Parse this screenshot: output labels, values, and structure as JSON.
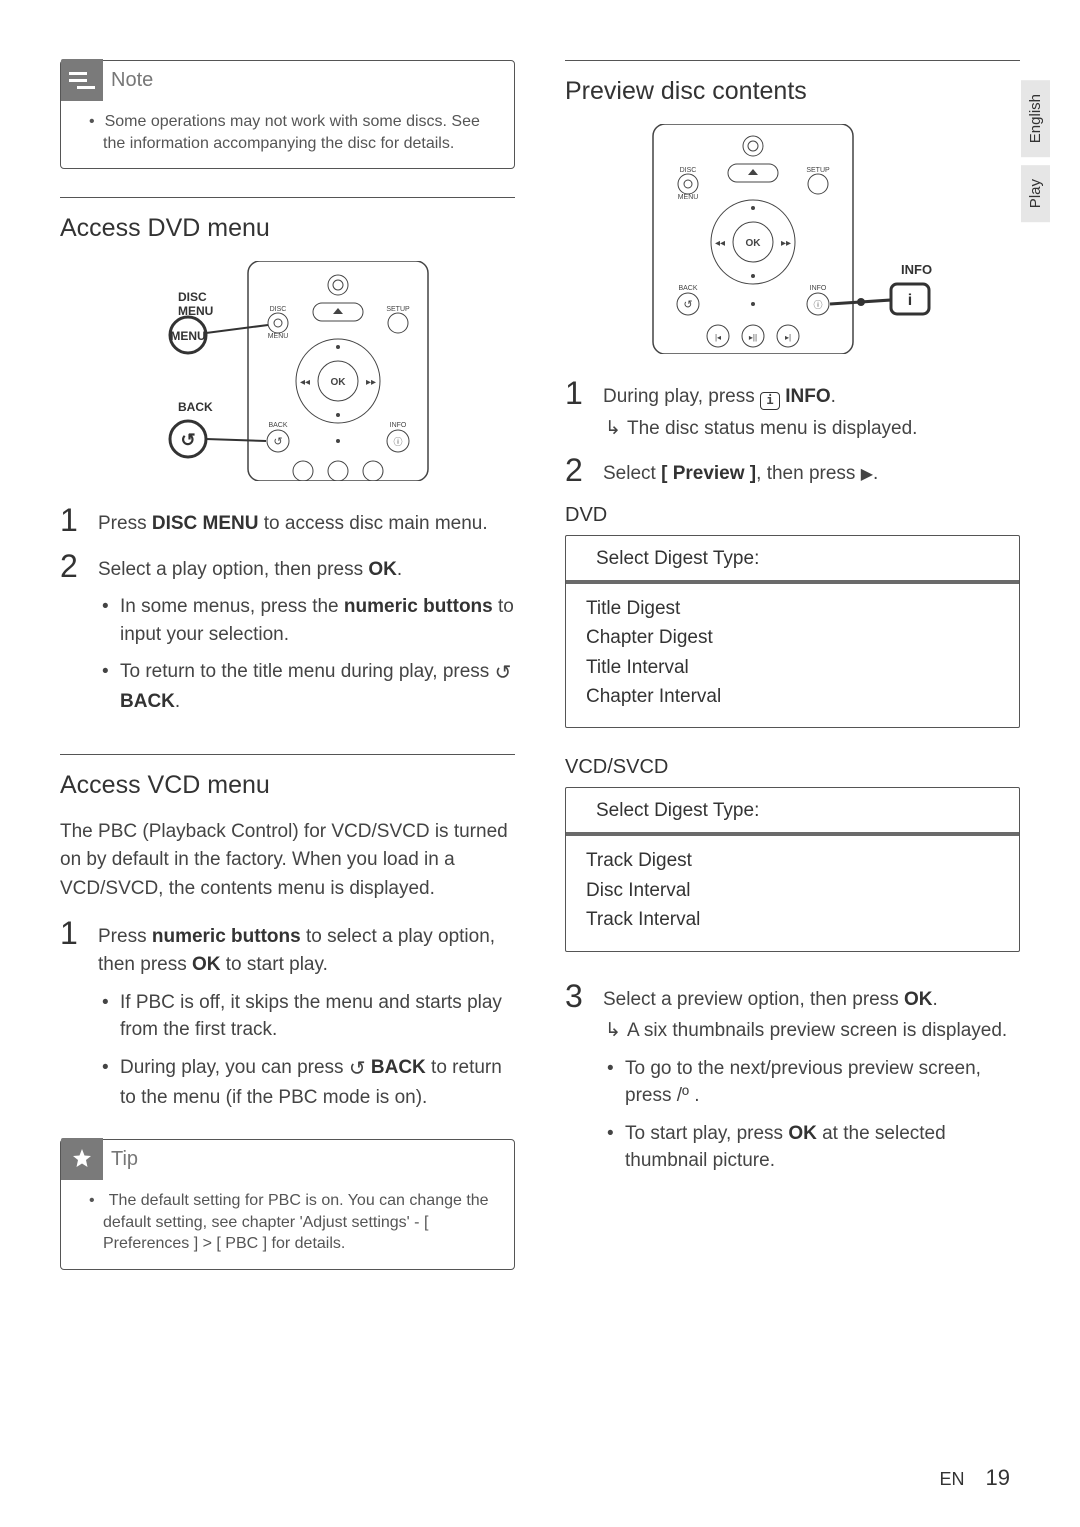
{
  "sideTabs": {
    "lang": "English",
    "section": "Play"
  },
  "note": {
    "title": "Note",
    "text": "Some operations may not work with some discs. See the information accompanying the disc for details."
  },
  "left": {
    "sec1_title": "Access DVD menu",
    "remote_labels_1": {
      "disc_menu": "DISC MENU",
      "back": "BACK"
    },
    "step1": {
      "pre": "Press ",
      "bold": "DISC MENU",
      "post": " to access disc main menu."
    },
    "step2": {
      "pre": "Select a play option, then press ",
      "bold": "OK",
      "post": "."
    },
    "step2_b1": {
      "pre": "In some menus, press the ",
      "bold": "numeric buttons",
      "post": " to input your selection."
    },
    "step2_b2": {
      "pre": "To return to the title menu during play, press ",
      "sym": "↺",
      "bold": " BACK",
      "post": "."
    },
    "sec2_title": "Access VCD menu",
    "sec2_intro": "The PBC (Playback Control) for VCD/SVCD is turned on by default in the factory. When you load in a VCD/SVCD, the contents menu is displayed.",
    "sec2_step1": {
      "pre": "Press ",
      "bold": "numeric buttons",
      "mid": " to select a play option, then press ",
      "bold2": "OK",
      "post": " to start play."
    },
    "sec2_b1": "If PBC is off, it skips the menu and starts play from the first track.",
    "sec2_b2": {
      "pre": "During play, you can press ",
      "sym": "↺",
      "bold": " BACK",
      "post": " to return to the menu (if the PBC mode is on)."
    }
  },
  "tip": {
    "title": "Tip",
    "text_pre": "The default setting for PBC is on. You can change the default setting, see chapter 'Adjust settings' - ",
    "path1": "[ Preferences ]",
    "gt": " > ",
    "path2": "[ PBC ]",
    "post": " for details."
  },
  "right": {
    "sec_title": "Preview disc contents",
    "remote_label_info": "INFO",
    "step1": {
      "pre": "During play, press ",
      "icon": "i",
      "bold": " INFO",
      "post": "."
    },
    "step1_arrow": "The disc status menu is displayed.",
    "step2": {
      "pre": "Select ",
      "bold": "[ Preview ]",
      "mid": ", then press ",
      "tri": "▶",
      "post": "."
    },
    "dvd_heading": "DVD",
    "dvd_box": {
      "head": "Select Digest Type:",
      "items": [
        "Title Digest",
        "Chapter Digest",
        "Title Interval",
        "Chapter Interval"
      ]
    },
    "vcd_heading": "VCD/SVCD",
    "vcd_box": {
      "head": "Select Digest Type:",
      "items": [
        "Track Digest",
        "Disc Interval",
        "Track Interval"
      ]
    },
    "step3": {
      "pre": "Select a preview option, then press ",
      "bold": "OK",
      "post": "."
    },
    "step3_arrow": "A six thumbnails preview screen is displayed.",
    "step3_b1": {
      "pre": "To go to the next/previous preview screen, press ",
      "keys": "  /º  ",
      "post": "."
    },
    "step3_b2": {
      "pre": "To start play, press ",
      "bold": "OK",
      "post": " at the selected thumbnail picture."
    }
  },
  "footer": {
    "lang": "EN",
    "page": "19"
  }
}
